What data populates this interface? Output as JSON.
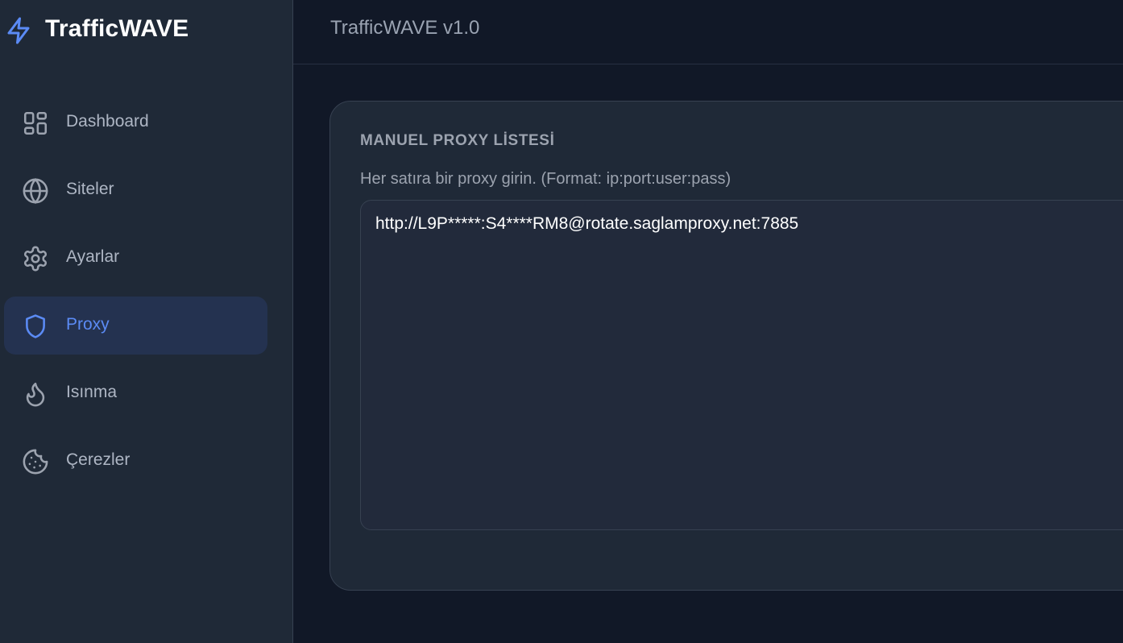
{
  "brand": {
    "name": "TrafficWAVE",
    "icon": "lightning-bolt-icon"
  },
  "header": {
    "title": "TrafficWAVE v1.0"
  },
  "sidebar": {
    "items": [
      {
        "label": "Dashboard",
        "icon": "dashboard-grid-icon",
        "active": false
      },
      {
        "label": "Siteler",
        "icon": "globe-icon",
        "active": false
      },
      {
        "label": "Ayarlar",
        "icon": "gear-icon",
        "active": false
      },
      {
        "label": "Proxy",
        "icon": "shield-icon",
        "active": true
      },
      {
        "label": "Isınma",
        "icon": "flame-icon",
        "active": false
      },
      {
        "label": "Çerezler",
        "icon": "cookie-icon",
        "active": false
      }
    ]
  },
  "main": {
    "card": {
      "title": "MANUEL PROXY LİSTESİ",
      "hint": "Her satıra bir proxy girin. (Format: ip:port:user:pass)",
      "textarea_value": "http://L9P*****:S4****RM8@rotate.saglamproxy.net:7885"
    }
  },
  "colors": {
    "sidebar_bg": "#1f2937",
    "main_bg": "#111827",
    "accent": "#5b8bf5",
    "active_bg": "#243250"
  }
}
